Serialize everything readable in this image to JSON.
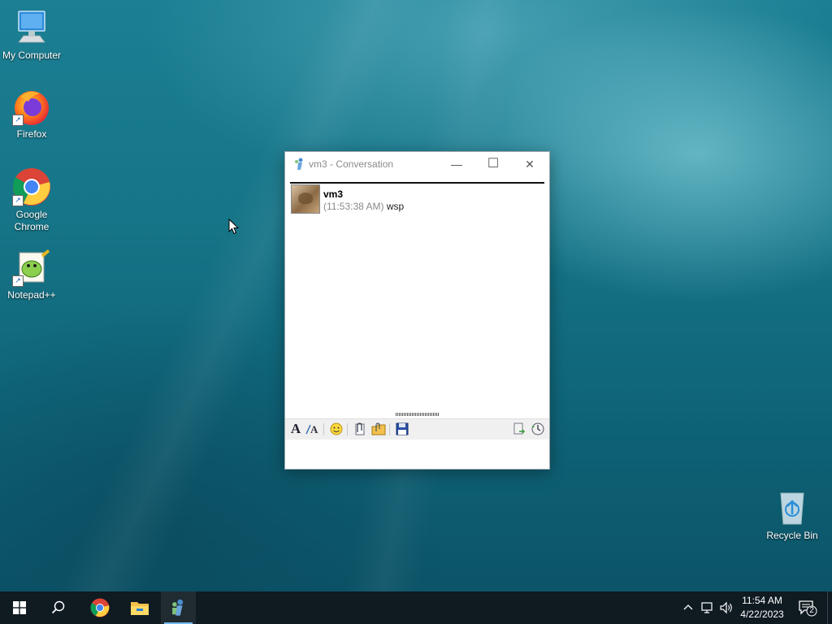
{
  "desktop": {
    "icons": [
      {
        "label": "My Computer",
        "icon": "computer-icon"
      },
      {
        "label": "Firefox",
        "icon": "firefox-icon"
      },
      {
        "label": "Google Chrome",
        "icon": "chrome-icon"
      },
      {
        "label": "Notepad++",
        "icon": "notepadpp-icon"
      }
    ],
    "recycle_bin": {
      "label": "Recycle Bin",
      "icon": "recycle-bin-icon"
    }
  },
  "conversation_window": {
    "title": "vm3 - Conversation",
    "controls": {
      "minimize": "—",
      "maximize": "☐",
      "close": "✕"
    },
    "messages": [
      {
        "sender": "vm3",
        "timestamp": "(11:53:38 AM)",
        "text": "wsp"
      }
    ],
    "toolbar": {
      "font": "A",
      "tools": [
        "font-icon",
        "text-color-icon",
        "emoticon-icon",
        "attach-file-icon",
        "send-folder-icon",
        "save-icon",
        "log-icon",
        "history-icon"
      ]
    },
    "input_value": ""
  },
  "taskbar": {
    "apps": [
      "start-icon",
      "search-icon",
      "chrome-icon",
      "file-explorer-icon",
      "messenger-icon"
    ],
    "clock": {
      "time": "11:54 AM",
      "date": "4/22/2023"
    },
    "notifications_count": "2"
  },
  "colors": {
    "taskbar": "#0f1a21",
    "accent": "#76b9ed",
    "timestamp_gray": "#8a8a8a"
  }
}
